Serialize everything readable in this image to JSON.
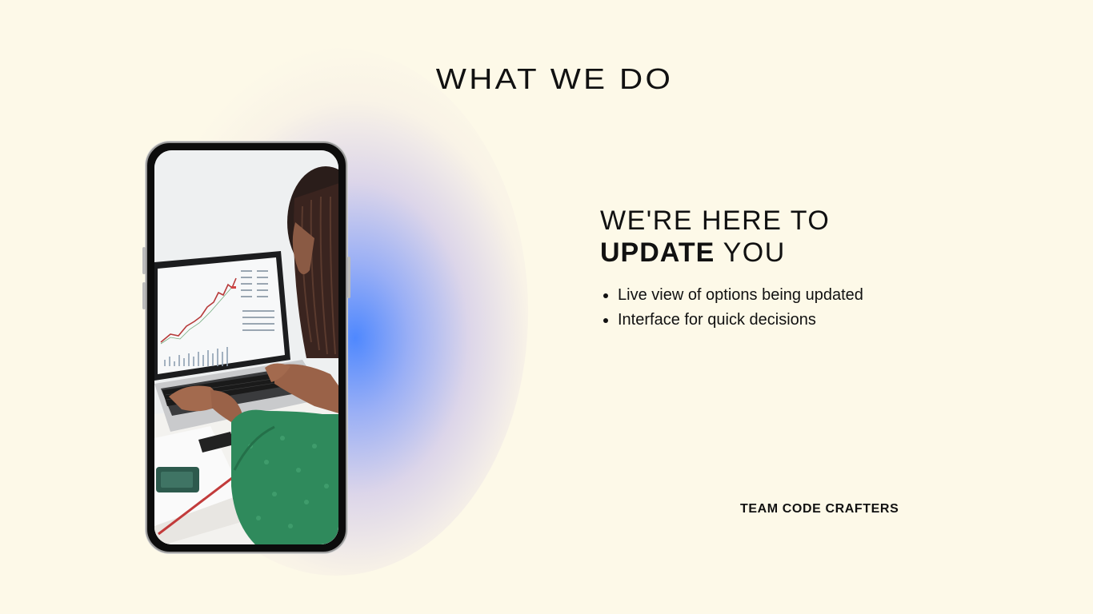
{
  "header": {
    "title": "WHAT WE DO"
  },
  "hero": {
    "line1": "WE'RE HERE TO",
    "line2_bold": "UPDATE",
    "line2_rest": " YOU"
  },
  "features": {
    "items": [
      "Live view of options being updated",
      "Interface for quick decisions"
    ]
  },
  "footer": {
    "team": "TEAM CODE CRAFTERS"
  },
  "colors": {
    "background": "#fdf9e8",
    "glow": "#4682ff",
    "text": "#111111"
  }
}
